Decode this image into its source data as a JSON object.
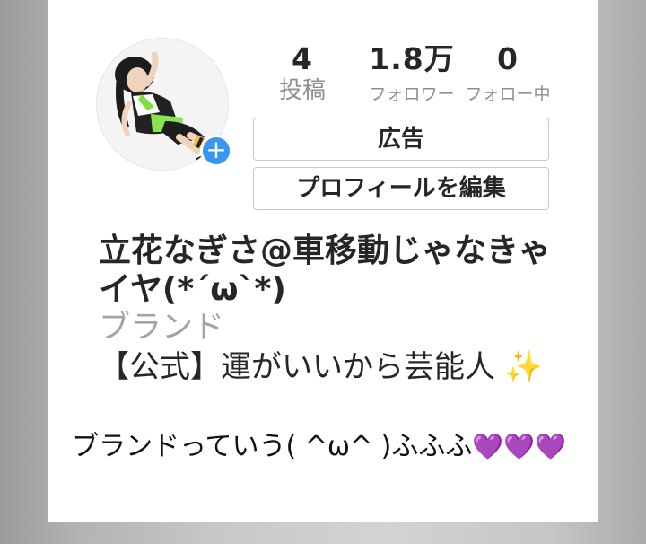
{
  "profile": {
    "stats": [
      {
        "value": "4",
        "label": "投稿"
      },
      {
        "value": "1.8万",
        "label": "フォロワー"
      },
      {
        "value": "0",
        "label": "フォロー中"
      }
    ],
    "ad_button_label": "広告",
    "edit_profile_label": "プロフィールを編集",
    "name": "立花なぎさ@車移動じゃなきゃイヤ(*´ω`*)",
    "category": "ブランド",
    "bio_text": "【公式】運がいいから芸能人",
    "bio_emoji": "✨",
    "add_icon": "plus-icon"
  },
  "caption": {
    "text": "ブランドっていう( ^ω^ )ふふふ",
    "hearts": "💜💜💜"
  },
  "colors": {
    "accent_blue": "#3897f0",
    "text_dark": "#262626",
    "text_gray": "#8e8e8e",
    "heart_purple": "#9b3fe6"
  }
}
